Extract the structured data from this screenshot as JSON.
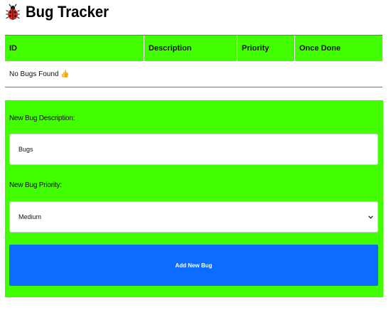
{
  "header": {
    "title": "Bug Tracker",
    "icon": "ladybug-icon"
  },
  "table": {
    "columns": [
      "ID",
      "Description",
      "Priority",
      "Once Done"
    ],
    "empty_message": "No Bugs Found 👍"
  },
  "form": {
    "description_label": "New Bug Description:",
    "description_value": "Bugs",
    "priority_label": "New Bug Priority:",
    "priority_selected": "Medium",
    "submit_label": "Add New Bug"
  },
  "colors": {
    "accent_green": "#42ff00",
    "button_blue": "#0b6cff"
  }
}
